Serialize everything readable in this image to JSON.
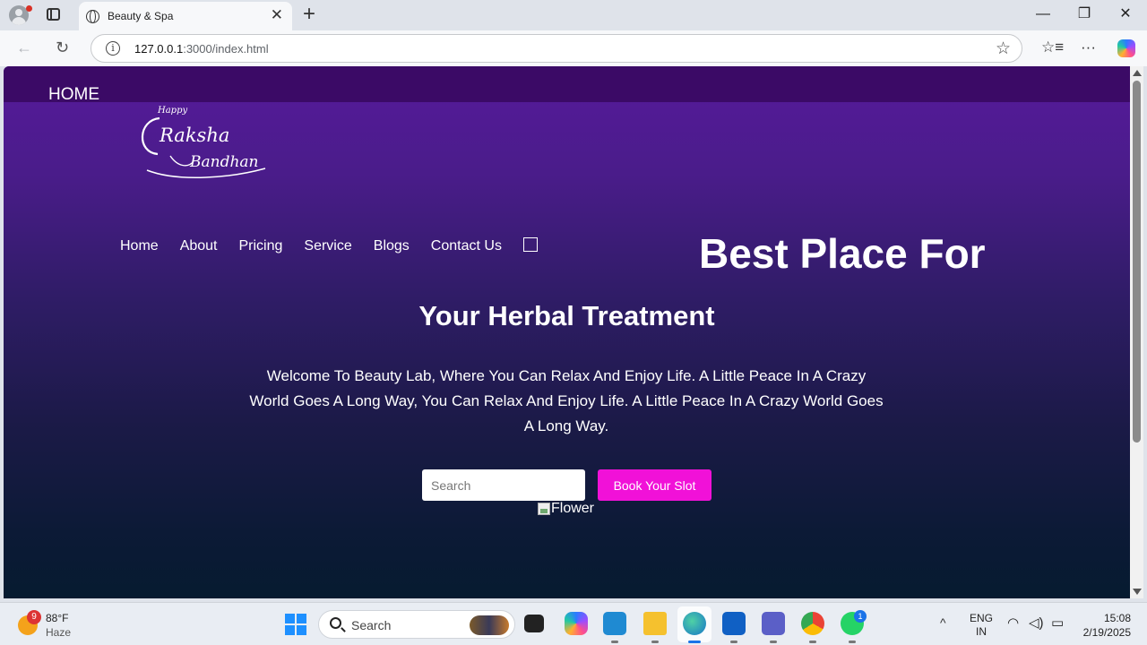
{
  "browser": {
    "tab_title": "Beauty & Spa",
    "tab_close": "✕",
    "new_tab": "+",
    "url_host": "127.0.0.1",
    "url_rest": ":3000/index.html",
    "window_controls": {
      "minimize": "—",
      "restore": "❐",
      "close": "✕"
    },
    "back": "←",
    "reload": "↻",
    "star": "☆",
    "favorites": "☆≡",
    "more": "···",
    "info": "i"
  },
  "page": {
    "top_label": "HOME",
    "logo": {
      "line1": "Happy",
      "line2": "Raksha",
      "line3": "Bandhan"
    },
    "nav": [
      "Home",
      "About",
      "Pricing",
      "Service",
      "Blogs",
      "Contact Us"
    ],
    "hero_title_1": "Best Place For",
    "hero_title_2": "Your Herbal Treatment",
    "hero_text": "Welcome To Beauty Lab, Where You Can Relax And Enjoy Life. A Little Peace In A Crazy World Goes A Long Way, You Can Relax And Enjoy Life. A Little Peace In A Crazy World Goes A Long Way.",
    "search_placeholder": "Search",
    "book_button": "Book Your Slot",
    "image_alt": "Flower"
  },
  "taskbar": {
    "weather_temp": "88°F",
    "weather_cond": "Haze",
    "weather_badge": "9",
    "search_label": "Search",
    "whatsapp_badge": "1",
    "lang_1": "ENG",
    "lang_2": "IN",
    "time": "15:08",
    "date": "2/19/2025",
    "tray_chevron": "^",
    "apps": [
      "file-explorer-icon",
      "copilot-icon",
      "vscode-icon",
      "folder-icon",
      "edge-icon",
      "outlook-icon",
      "teams-icon",
      "chrome-icon",
      "whatsapp-icon"
    ]
  },
  "colors": {
    "book_button": "#f111d8",
    "top_strip": "#3b0a66",
    "gradient_top": "#561a9b",
    "gradient_bottom": "#061b30"
  }
}
